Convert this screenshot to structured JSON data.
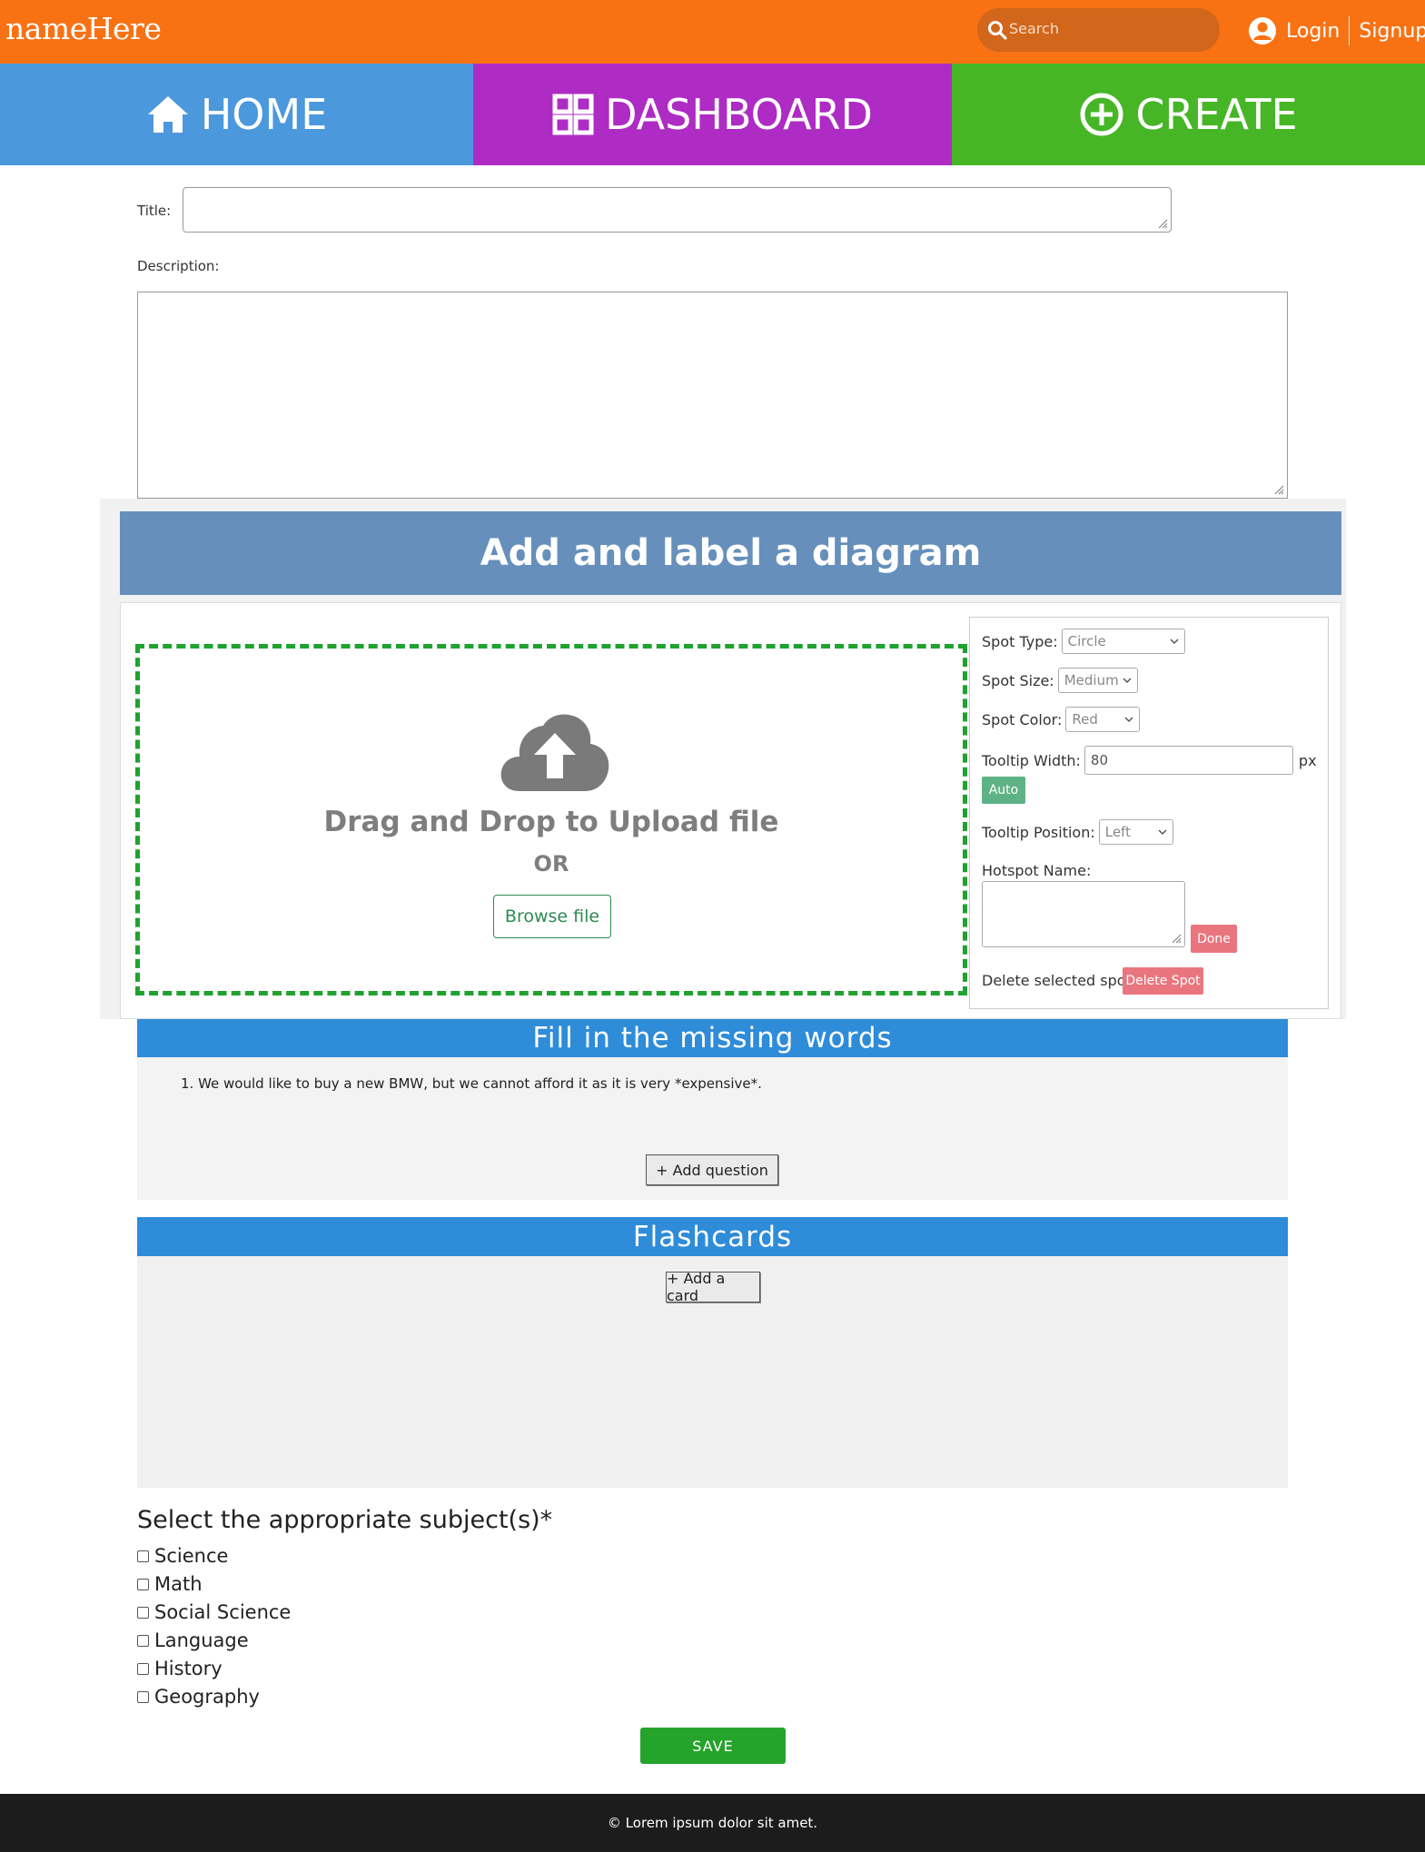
{
  "header": {
    "brand": "nameHere",
    "search_placeholder": "Search",
    "login": "Login",
    "signup": "Signup",
    "color": "#f87214"
  },
  "nav": {
    "home": "HOME",
    "dashboard": "DASHBOARD",
    "create": "CREATE",
    "colors": {
      "home": "#4c98dc",
      "dashboard": "#ae2bc4",
      "create": "#46b626"
    }
  },
  "form": {
    "title_label": "Title:",
    "title_value": "",
    "description_label": "Description:",
    "description_value": ""
  },
  "diagram": {
    "heading": "Add and label a diagram",
    "drop_title": "Drag and Drop to Upload file",
    "drop_or": "OR",
    "browse": "Browse file",
    "spot_type_label": "Spot Type:",
    "spot_type_value": "Circle",
    "spot_size_label": "Spot Size:",
    "spot_size_value": "Medium",
    "spot_color_label": "Spot Color:",
    "spot_color_value": "Red",
    "tooltip_width_label": "Tooltip Width:",
    "tooltip_width_value": "80",
    "tooltip_width_unit": "px",
    "auto": "Auto",
    "tooltip_position_label": "Tooltip Position:",
    "tooltip_position_value": "Left",
    "hotspot_name_label": "Hotspot Name:",
    "done": "Done",
    "delete_label": "Delete selected spot?",
    "delete_button": "Delete Spot"
  },
  "fill": {
    "heading": "Fill in the missing words",
    "questions": [
      "1. We would like to buy a new BMW, but we cannot afford it as it is very *expensive*."
    ],
    "add_question": "+ Add question"
  },
  "flashcards": {
    "heading": "Flashcards",
    "add_card": "+ Add a card"
  },
  "subjects": {
    "title": "Select the appropriate subject(s)*",
    "items": [
      "Science",
      "Math",
      "Social Science",
      "Language",
      "History",
      "Geography"
    ]
  },
  "save": "SAVE",
  "footer": "© Lorem ipsum dolor sit amet."
}
